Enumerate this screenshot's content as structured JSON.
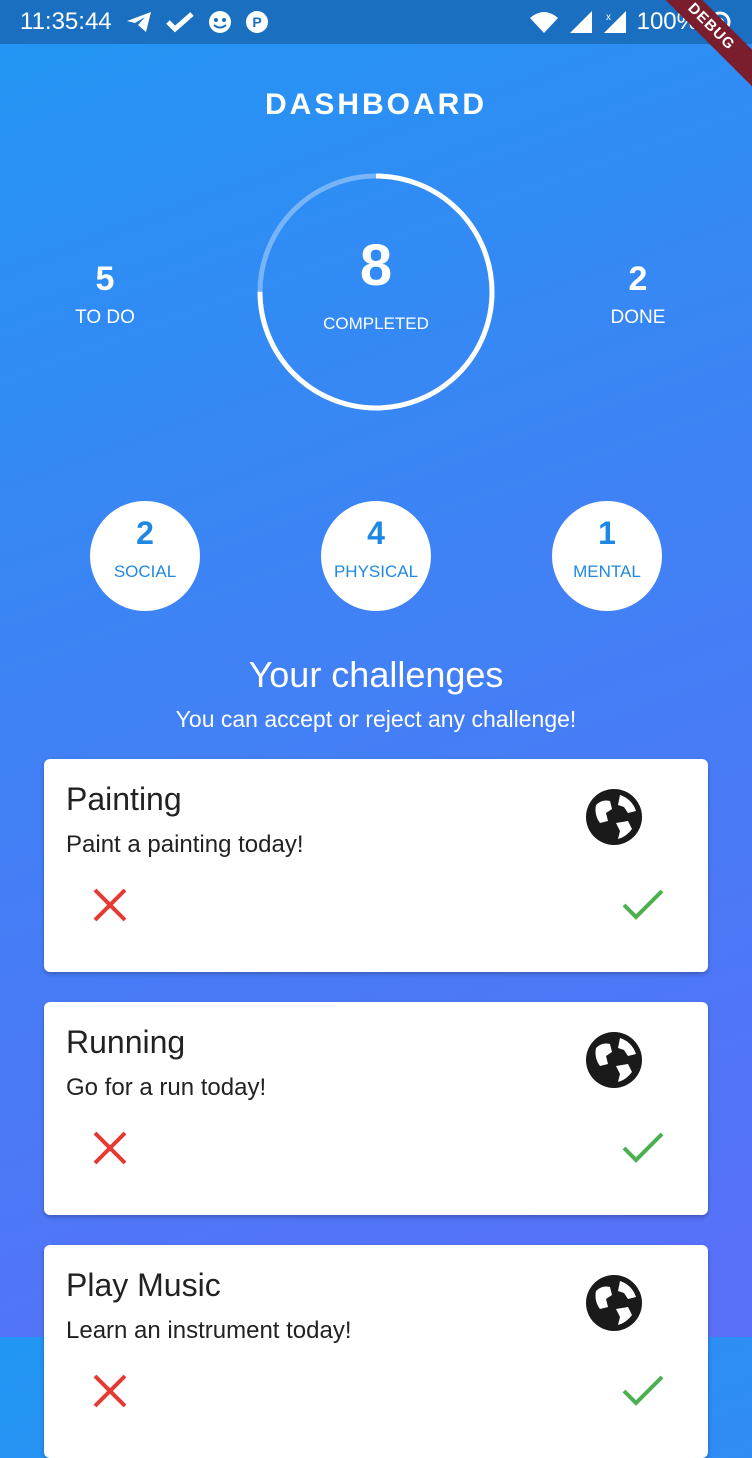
{
  "status_bar": {
    "time": "11:35:44",
    "battery": "100%",
    "icons": [
      "telegram-icon",
      "check-icon",
      "face-icon",
      "p-icon",
      "wifi-icon",
      "signal-icon",
      "signal-x-icon",
      "record-icon"
    ]
  },
  "debug_banner": "DEBUG",
  "header": {
    "title": "DASHBOARD"
  },
  "stats": {
    "todo": {
      "value": "5",
      "label": "TO DO"
    },
    "completed": {
      "value": "8",
      "label": "COMPLETED",
      "progress": 0.75
    },
    "done": {
      "value": "2",
      "label": "DONE"
    }
  },
  "categories": [
    {
      "value": "2",
      "label": "SOCIAL"
    },
    {
      "value": "4",
      "label": "PHYSICAL"
    },
    {
      "value": "1",
      "label": "MENTAL"
    }
  ],
  "challenges_section": {
    "title": "Your challenges",
    "subtitle": "You can accept or reject any challenge!"
  },
  "challenges": [
    {
      "title": "Painting",
      "description": "Paint a painting today!",
      "icon": "globe-icon"
    },
    {
      "title": "Running",
      "description": "Go for a run today!",
      "icon": "globe-icon"
    },
    {
      "title": "Play Music",
      "description": "Learn an instrument today!",
      "icon": "globe-icon"
    }
  ],
  "colors": {
    "accent_blue": "#1e88e5",
    "reject_red": "#e53935",
    "accept_green": "#4caf50",
    "debug_banner": "#7a1d2c"
  }
}
